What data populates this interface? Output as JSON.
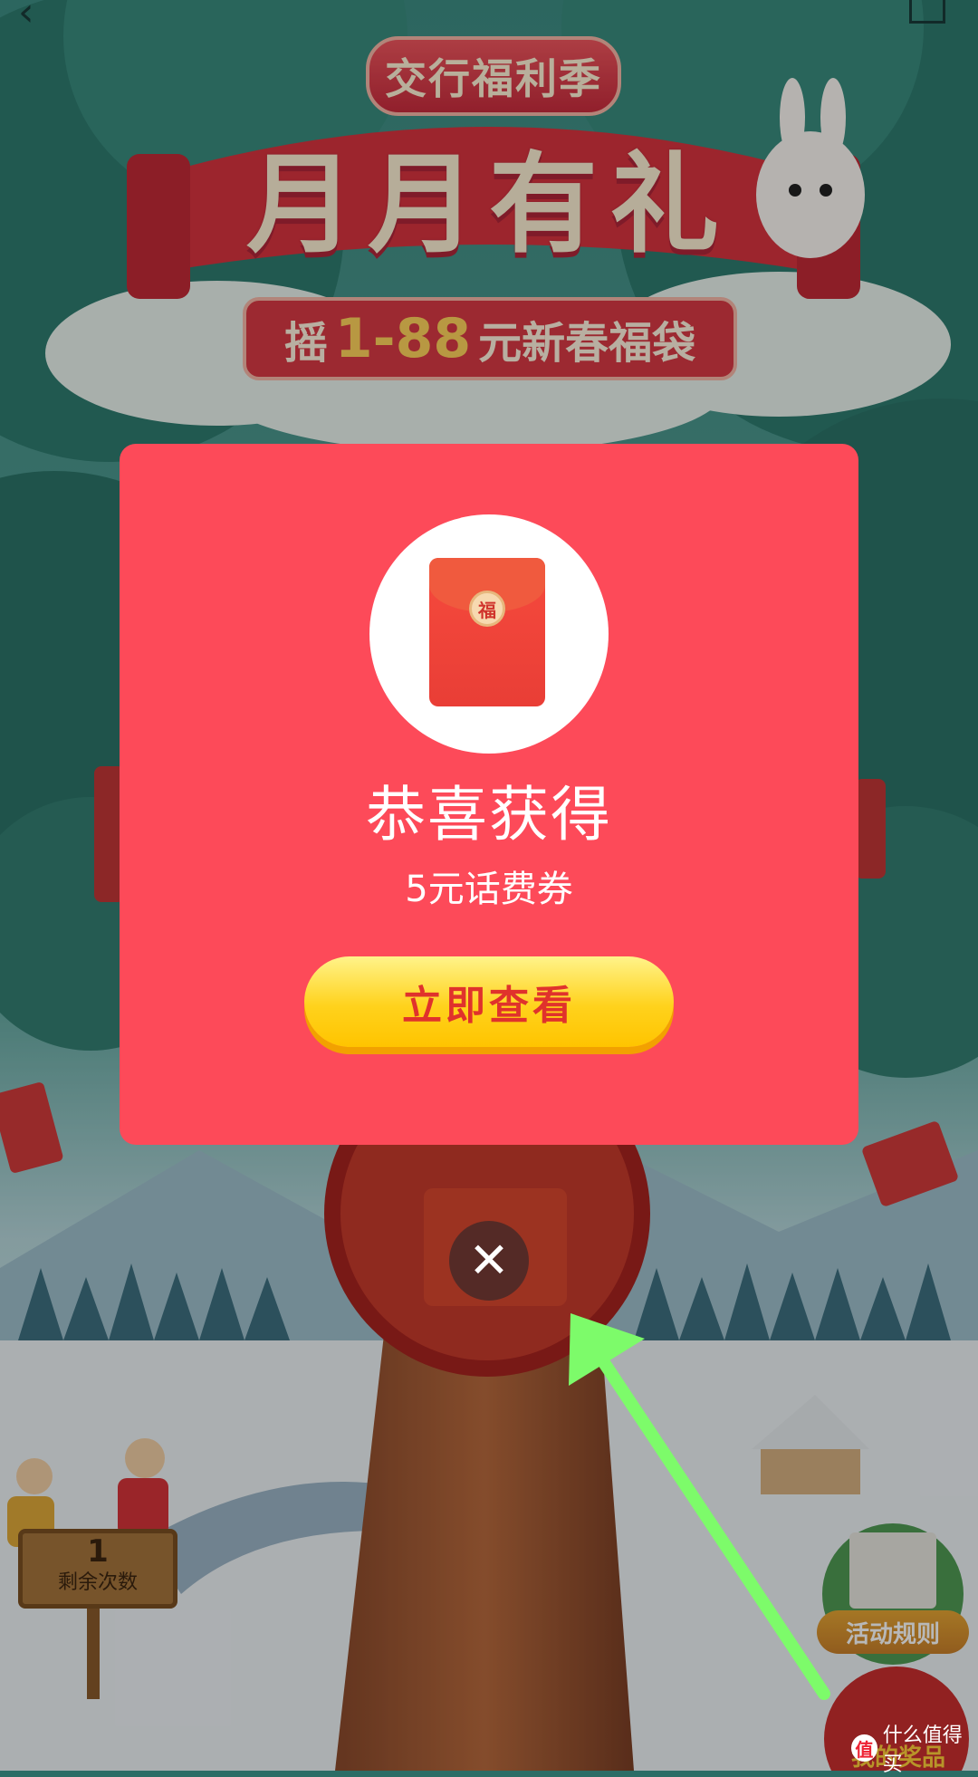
{
  "header": {
    "badge": "交行福利季",
    "title": "月月有礼",
    "subtitle_prefix": "摇",
    "subtitle_range": "1-88",
    "subtitle_suffix": "元新春福袋"
  },
  "nav": {
    "back_icon": "chevron-left-icon",
    "share_icon": "share-icon"
  },
  "counter": {
    "count": "1",
    "label": "剩余次数"
  },
  "side_buttons": {
    "rules": "活动规则",
    "prizes": "我的奖品"
  },
  "watermark": {
    "logo": "值",
    "text": "什么值得买"
  },
  "modal": {
    "envelope_seal": "福",
    "title": "恭喜获得",
    "prize": "5元话费券",
    "cta": "立即查看",
    "close_icon": "close-icon"
  },
  "annotation": {
    "arrow_color": "#7dfb6a"
  },
  "colors": {
    "modal_bg": "#fd4a59",
    "cta_text": "#e0322c",
    "cta_bg": "#ffd21c"
  }
}
